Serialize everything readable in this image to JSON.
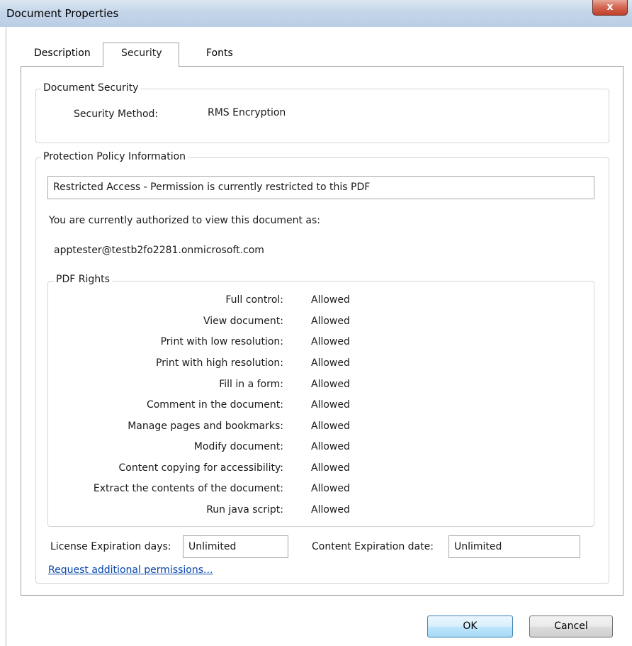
{
  "window": {
    "title": "Document Properties",
    "close_glyph": "x"
  },
  "tabs": [
    {
      "label": "Description",
      "active": false
    },
    {
      "label": "Security",
      "active": true
    },
    {
      "label": "Fonts",
      "active": false
    }
  ],
  "document_security": {
    "legend": "Document Security",
    "method_label": "Security Method:",
    "method_value": "RMS Encryption"
  },
  "protection_policy": {
    "legend": "Protection Policy Information",
    "restriction_text": "Restricted Access - Permission is currently restricted to this PDF",
    "authorized_text": "You are currently authorized to view this document as:",
    "user_email": "apptester@testb2fo2281.onmicrosoft.com"
  },
  "pdf_rights": {
    "legend": "PDF Rights",
    "rows": [
      {
        "label": "Full control:",
        "value": "Allowed"
      },
      {
        "label": "View document:",
        "value": "Allowed"
      },
      {
        "label": "Print with low resolution:",
        "value": "Allowed"
      },
      {
        "label": "Print with high resolution:",
        "value": "Allowed"
      },
      {
        "label": "Fill in a form:",
        "value": "Allowed"
      },
      {
        "label": "Comment in the document:",
        "value": "Allowed"
      },
      {
        "label": "Manage pages and bookmarks:",
        "value": "Allowed"
      },
      {
        "label": "Modify document:",
        "value": "Allowed"
      },
      {
        "label": "Content copying for accessibility:",
        "value": "Allowed"
      },
      {
        "label": "Extract the contents of the document:",
        "value": "Allowed"
      },
      {
        "label": "Run java script:",
        "value": "Allowed"
      }
    ]
  },
  "expiration": {
    "license_label": "License Expiration days:",
    "license_value": "Unlimited",
    "content_label": "Content Expiration date:",
    "content_value": "Unlimited"
  },
  "request_link": "Request additional permissions...",
  "buttons": {
    "ok": "OK",
    "cancel": "Cancel"
  },
  "colors": {
    "link": "#0645ad",
    "close_button": "#c0402a",
    "titlebar": "#c5d6ea"
  }
}
